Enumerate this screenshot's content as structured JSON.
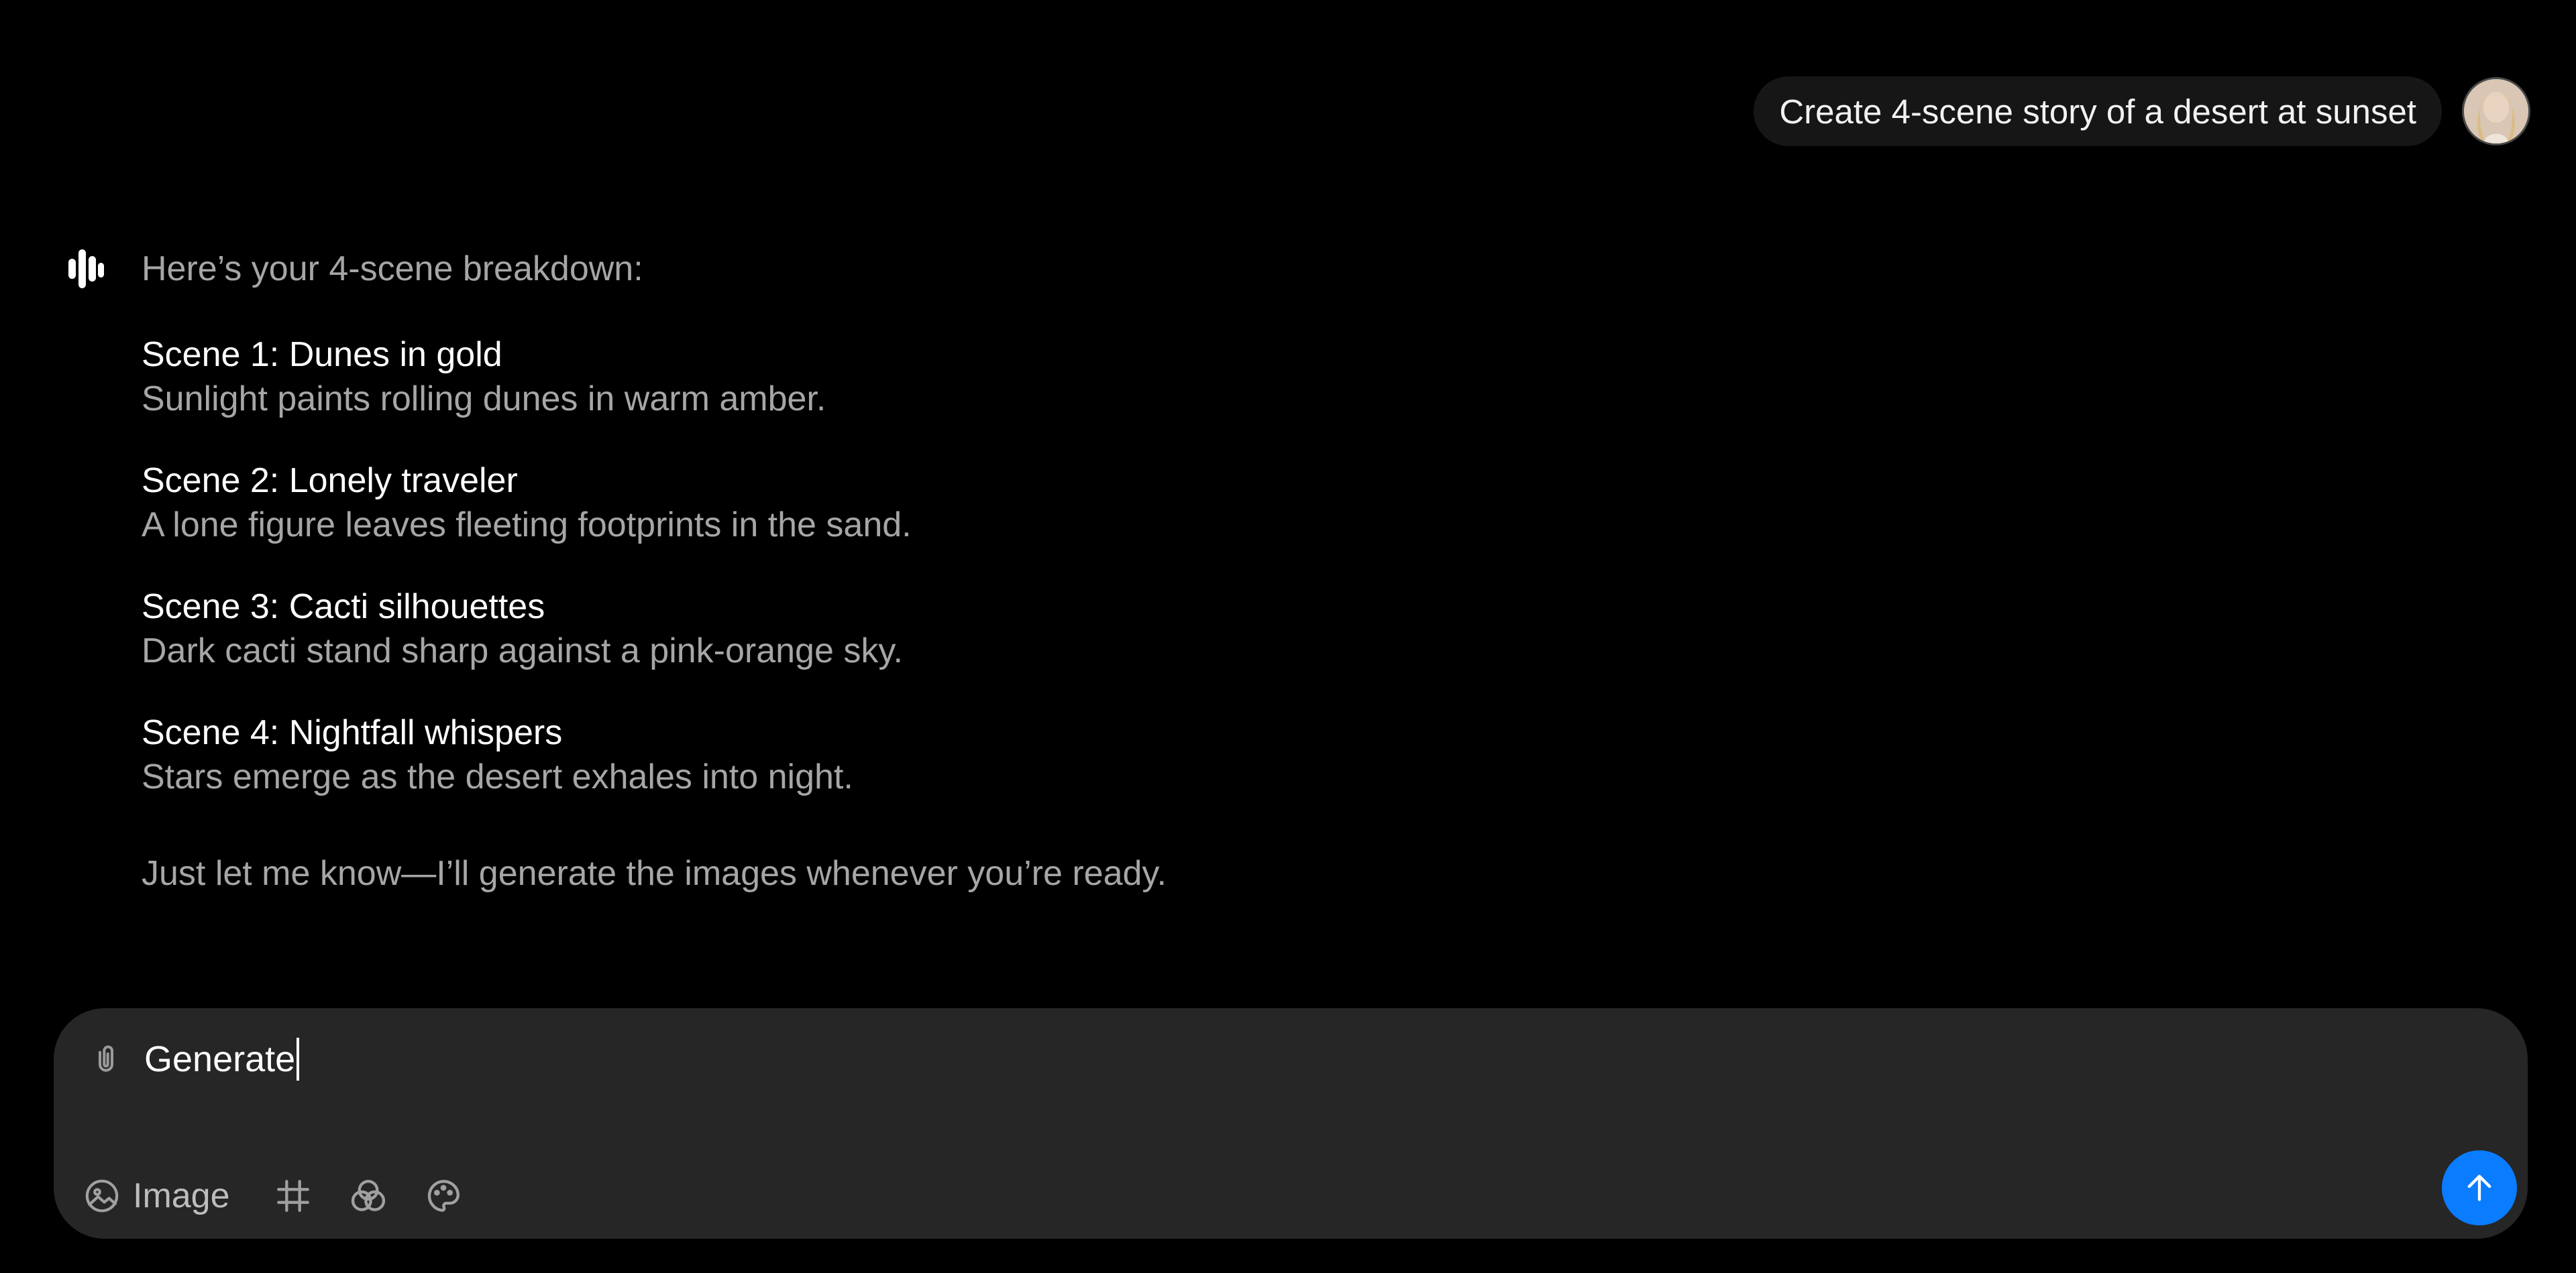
{
  "user_message": {
    "text": "Create 4-scene story of a desert at sunset",
    "avatar_icon": "user-avatar"
  },
  "assistant": {
    "logo_icon": "assistant-logo-icon",
    "intro": "Here’s your 4-scene breakdown:",
    "scenes": [
      {
        "title": "Scene 1: Dunes in gold",
        "description": "Sunlight paints rolling dunes in warm amber."
      },
      {
        "title": "Scene 2: Lonely traveler",
        "description": "A lone figure leaves fleeting footprints in the sand."
      },
      {
        "title": "Scene 3: Cacti silhouettes",
        "description": "Dark cacti stand sharp against a pink-orange sky."
      },
      {
        "title": "Scene 4: Nightfall whispers",
        "description": "Stars emerge as the desert exhales into night."
      }
    ],
    "outro": "Just let me know—I’ll generate the images whenever you’re ready."
  },
  "composer": {
    "value": "Generate",
    "attach_icon": "paperclip-icon",
    "tools": {
      "image_label": "Image",
      "image_icon": "image-icon",
      "frame_icon": "hash-icon",
      "blend_icon": "blend-icon",
      "palette_icon": "palette-icon"
    },
    "send_icon": "arrow-up-icon"
  },
  "colors": {
    "background": "#000000",
    "bubble": "#161616",
    "composer": "#262626",
    "muted_text": "#a6a6a6",
    "accent": "#0a7cff"
  }
}
